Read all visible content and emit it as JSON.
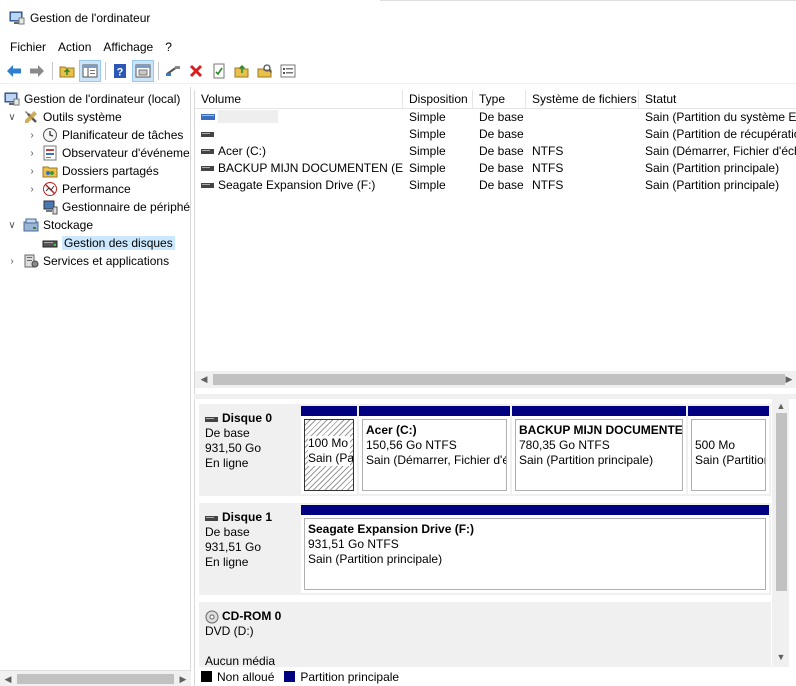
{
  "window": {
    "title": "Gestion de l'ordinateur"
  },
  "menu": [
    "Fichier",
    "Action",
    "Affichage",
    "?"
  ],
  "toolbar": {
    "buttons": [
      "back-icon",
      "forward-icon",
      "folder-up-icon",
      "show-tree-icon",
      "help-icon",
      "console-icon",
      "connect-icon",
      "delete-icon",
      "properties-icon",
      "open-icon",
      "search-icon",
      "list-icon"
    ]
  },
  "tree": {
    "items": [
      {
        "label": "Gestion de l'ordinateur (local)",
        "icon": "computer-management-icon",
        "level": 0
      },
      {
        "label": "Outils système",
        "icon": "tools-icon",
        "level": 1,
        "expanded": true
      },
      {
        "label": "Planificateur de tâches",
        "icon": "clock-icon",
        "level": 2
      },
      {
        "label": "Observateur d'événements",
        "icon": "event-viewer-icon",
        "level": 2
      },
      {
        "label": "Dossiers partagés",
        "icon": "shared-folder-icon",
        "level": 2
      },
      {
        "label": "Performance",
        "icon": "performance-icon",
        "level": 2
      },
      {
        "label": "Gestionnaire de périphériques",
        "icon": "device-manager-icon",
        "level": 2
      },
      {
        "label": "Stockage",
        "icon": "storage-icon",
        "level": 1,
        "expanded": true
      },
      {
        "label": "Gestion des disques",
        "icon": "disk-management-icon",
        "level": 2,
        "selected": true
      },
      {
        "label": "Services et applications",
        "icon": "services-icon",
        "level": 1
      }
    ]
  },
  "volumes": {
    "columns": [
      "Volume",
      "Disposition",
      "Type",
      "Système de fichiers",
      "Statut"
    ],
    "rows": [
      {
        "volume": "",
        "layout": "Simple",
        "type": "De base",
        "fs": "",
        "status": "Sain (Partition du système EFI)"
      },
      {
        "volume": "",
        "layout": "Simple",
        "type": "De base",
        "fs": "",
        "status": "Sain (Partition de récupération)"
      },
      {
        "volume": "Acer (C:)",
        "layout": "Simple",
        "type": "De base",
        "fs": "NTFS",
        "status": "Sain (Démarrer, Fichier d'échange)"
      },
      {
        "volume": "BACKUP MIJN DOCUMENTEN (E:)",
        "layout": "Simple",
        "type": "De base",
        "fs": "NTFS",
        "status": "Sain (Partition principale)"
      },
      {
        "volume": "Seagate Expansion Drive (F:)",
        "layout": "Simple",
        "type": "De base",
        "fs": "NTFS",
        "status": "Sain (Partition principale)"
      }
    ]
  },
  "disks": [
    {
      "name": "Disque 0",
      "kind": "De base",
      "size": "931,50 Go",
      "state": "En ligne",
      "partitions": [
        {
          "name": "",
          "size": "100 Mo",
          "status": "Sain (Partition du système EFI)",
          "hatched": true
        },
        {
          "name": "Acer  (C:)",
          "size": "150,56 Go NTFS",
          "status": "Sain (Démarrer, Fichier d'échange)"
        },
        {
          "name": "BACKUP MIJN DOCUMENTEN",
          "size": "780,35 Go NTFS",
          "status": "Sain (Partition principale)"
        },
        {
          "name": "",
          "size": "500 Mo",
          "status": "Sain (Partition de récupération)"
        }
      ]
    },
    {
      "name": "Disque 1",
      "kind": "De base",
      "size": "931,51 Go",
      "state": "En ligne",
      "partitions": [
        {
          "name": "Seagate Expansion Drive  (F:)",
          "size": "931,51 Go NTFS",
          "status": "Sain (Partition principale)"
        }
      ]
    },
    {
      "name": "CD-ROM 0",
      "kind": "DVD (D:)",
      "size": "",
      "state": "Aucun média",
      "partitions": []
    }
  ],
  "legend": [
    {
      "label": "Non alloué",
      "color": "#000000"
    },
    {
      "label": "Partition principale",
      "color": "#000080"
    }
  ]
}
